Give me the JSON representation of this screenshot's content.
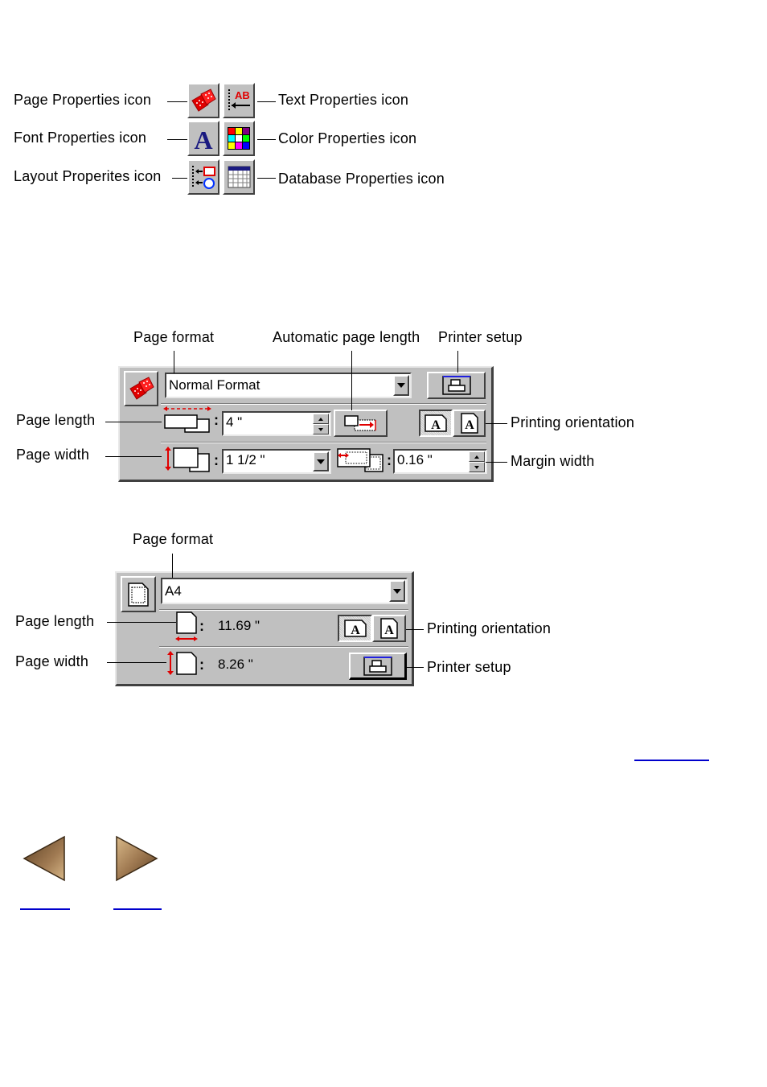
{
  "icon_legend": {
    "left_labels": [
      "Page Properties icon",
      "Font Properties icon",
      "Layout Properites icon"
    ],
    "right_labels": [
      "Text Properties icon",
      "Color Properties icon",
      "Database Properties icon"
    ],
    "icons": [
      "page-properties-icon",
      "text-properties-icon",
      "font-properties-icon",
      "color-properties-icon",
      "layout-properties-icon",
      "database-properties-icon"
    ],
    "color_grid": [
      "#ff0000",
      "#ffff00",
      "#800080",
      "#00ffff",
      "#ffffff",
      "#00ff00",
      "#ffff00",
      "#ff00ff",
      "#0000ff"
    ]
  },
  "panel1": {
    "callouts": {
      "page_format": "Page format",
      "automatic_page_length": "Automatic page length",
      "printer_setup": "Printer setup",
      "page_length": "Page length",
      "page_width": "Page width",
      "printing_orientation": "Printing orientation",
      "margin_width": "Margin width"
    },
    "page_format_value": "Normal Format",
    "page_length_value": "4 \"",
    "page_width_value": "1 1/2 \"",
    "margin_width_value": "0.16 \"",
    "colon": ":"
  },
  "panel2": {
    "callouts": {
      "page_format": "Page format",
      "page_length": "Page length",
      "page_width": "Page width",
      "printing_orientation": "Printing orientation",
      "printer_setup": "Printer setup"
    },
    "page_format_value": "A4",
    "page_length_value": "11.69 \"",
    "page_width_value": "8.26 \"",
    "colon": ":"
  },
  "nav": {
    "prev_icon": "arrow-left-icon",
    "next_icon": "arrow-right-icon"
  },
  "colors": {
    "panel_bg": "#c0c0c0",
    "accent_red": "#ff0000",
    "link_blue": "#0000cc",
    "arrow_brown": "#8b6a45"
  }
}
